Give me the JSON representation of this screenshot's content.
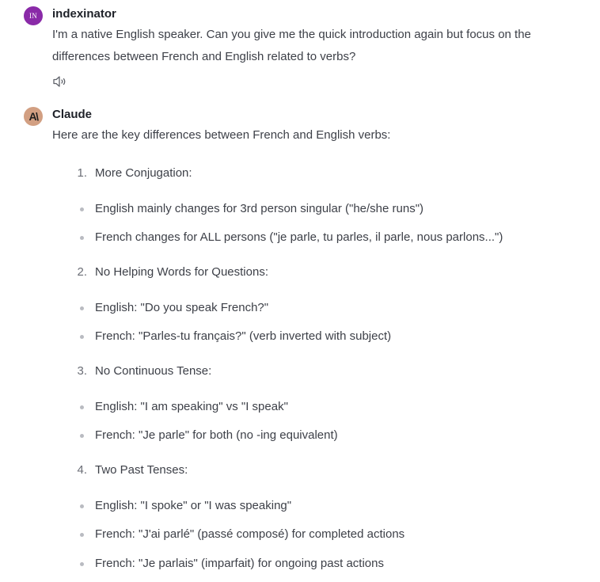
{
  "user_message": {
    "avatar_initials": "IN",
    "author": "indexinator",
    "lines": [
      "I'm a native English speaker. Can you give me the quick introduction again but focus on the",
      "differences between French and English related to verbs?"
    ],
    "speaker_icon": "speaker-icon"
  },
  "assistant_message": {
    "avatar_logo": "A\\",
    "author": "Claude",
    "intro": "Here are the key differences between French and English verbs:",
    "sections": [
      {
        "number": "1.",
        "heading": "More Conjugation:",
        "bullets": [
          "English mainly changes for 3rd person singular (\"he/she runs\")",
          "French changes for ALL persons (\"je parle, tu parles, il parle, nous parlons...\")"
        ]
      },
      {
        "number": "2.",
        "heading": "No Helping Words for Questions:",
        "bullets": [
          "English: \"Do you speak French?\"",
          "French: \"Parles-tu français?\" (verb inverted with subject)"
        ]
      },
      {
        "number": "3.",
        "heading": "No Continuous Tense:",
        "bullets": [
          "English: \"I am speaking\" vs \"I speak\"",
          "French: \"Je parle\" for both (no -ing equivalent)"
        ]
      },
      {
        "number": "4.",
        "heading": "Two Past Tenses:",
        "bullets": [
          "English: \"I spoke\" or \"I was speaking\"",
          "French: \"J'ai parlé\" (passé composé) for completed actions",
          "French: \"Je parlais\" (imparfait) for ongoing past actions"
        ]
      }
    ]
  },
  "colors": {
    "user_avatar": "#8a2aa8",
    "claude_avatar": "#d29f82",
    "text": "#3d4048",
    "author": "#1e2128",
    "bullet": "#b9bbc1"
  }
}
